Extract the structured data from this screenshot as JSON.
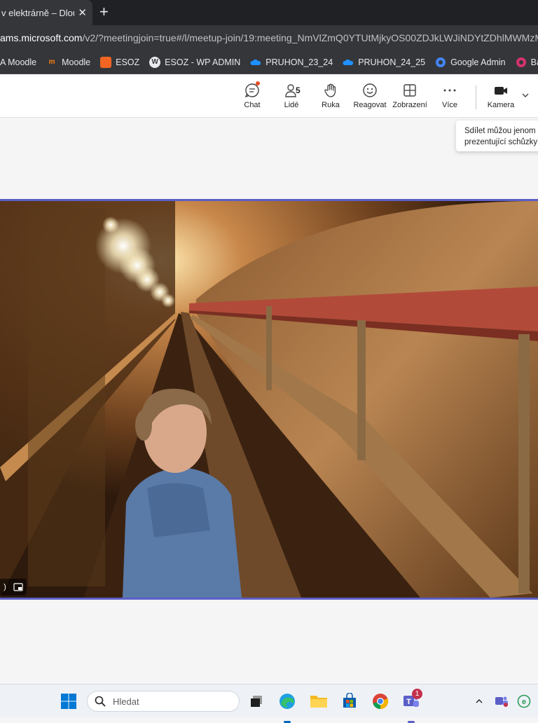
{
  "browser": {
    "tab_title": "v elektrárně – Dlou",
    "tab_close": "✕",
    "new_tab": "+",
    "url_host": "ams.microsoft.com",
    "url_path": "/v2/?meetingjoin=true#/l/meetup-join/19:meeting_NmVlZmQ0YTUtMjkyOS00ZDJkLWJiNDYtZDhlMWMzMz"
  },
  "bookmarks": [
    {
      "label": "A Moodle"
    },
    {
      "label": "Moodle"
    },
    {
      "label": "ESOZ"
    },
    {
      "label": "ESOZ - WP ADMIN"
    },
    {
      "label": "PRUHON_23_24"
    },
    {
      "label": "PRUHON_24_25"
    },
    {
      "label": "Google Admin"
    },
    {
      "label": "Bakalá"
    }
  ],
  "toolbar": {
    "chat": "Chat",
    "people": "Lidé",
    "people_count": "5",
    "hand": "Ruka",
    "react": "Reagovat",
    "view": "Zobrazení",
    "more": "Více",
    "camera": "Kamera"
  },
  "tooltip": {
    "line1": "Sdílet můžou jenom",
    "line2": "prezentující schůzky"
  },
  "taskbar": {
    "search_placeholder": "Hledat",
    "teams_badge": "1"
  },
  "colors": {
    "accent": "#5b5fc7",
    "notification": "#e94f24",
    "badge": "#c4314b"
  }
}
